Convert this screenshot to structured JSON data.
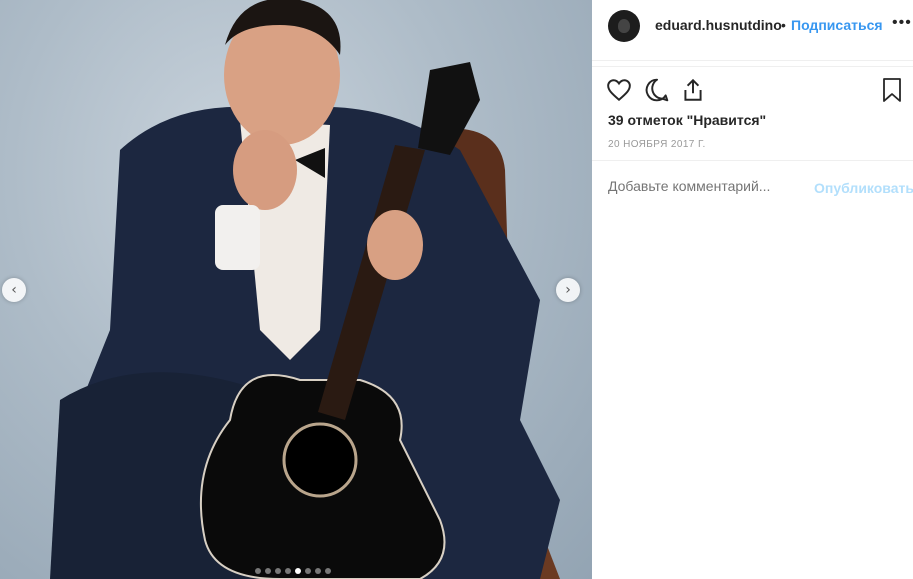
{
  "post": {
    "username": "eduard.husnutdino",
    "separator": "•",
    "follow_label": "Подписаться",
    "more_label": "•••",
    "likes_text": "39 отметок \"Нравится\"",
    "date_text": "20 НОЯБРЯ 2017 Г.",
    "comment_placeholder": "Добавьте комментарий...",
    "publish_label": "Опубликовать"
  },
  "carousel": {
    "total_slides": 8,
    "active_slide": 5,
    "prev_icon": "‹",
    "next_icon": "›"
  },
  "colors": {
    "accent": "#3897f0",
    "publish_disabled": "#b2dffc",
    "text": "#262626",
    "muted": "#999999"
  }
}
